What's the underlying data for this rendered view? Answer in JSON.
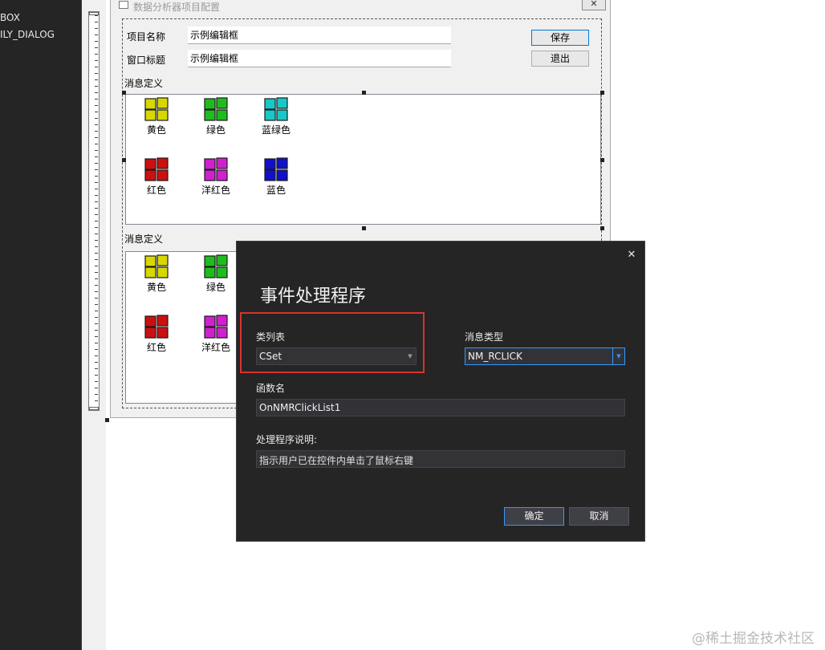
{
  "left_panel": {
    "tree_items": [
      "BOX",
      "ILY_DIALOG"
    ]
  },
  "design_dialog": {
    "title": "数据分析器项目配置",
    "close_glyph": "✕",
    "fields": [
      {
        "label": "项目名称",
        "value": "示例编辑框"
      },
      {
        "label": "窗口标题",
        "value": "示例编辑框"
      }
    ],
    "buttons": {
      "save": "保存",
      "exit": "退出"
    },
    "group1_label": "消息定义",
    "group2_label": "消息定义",
    "list1_items": [
      {
        "label": "黄色",
        "color": "#d8d800"
      },
      {
        "label": "绿色",
        "color": "#1ebd1e"
      },
      {
        "label": "蓝绿色",
        "color": "#18c8c8"
      },
      {
        "label": "红色",
        "color": "#cc1010"
      },
      {
        "label": "洋红色",
        "color": "#d020d0"
      },
      {
        "label": "蓝色",
        "color": "#1010c8"
      }
    ],
    "list2_items": [
      {
        "label": "黄色",
        "color": "#d8d800"
      },
      {
        "label": "绿色",
        "color": "#1ebd1e"
      },
      {
        "label": "红色",
        "color": "#cc1010"
      },
      {
        "label": "洋红色",
        "color": "#d020d0"
      }
    ]
  },
  "event_dialog": {
    "title": "事件处理程序",
    "close_glyph": "✕",
    "class_list_label": "类列表",
    "class_list_value": "CSet",
    "message_type_label": "消息类型",
    "message_type_value": "NM_RCLICK",
    "function_name_label": "函数名",
    "function_name_value": "OnNMRClickList1",
    "description_label": "处理程序说明:",
    "description_value": "指示用户已在控件内单击了鼠标右键",
    "ok_label": "确定",
    "cancel_label": "取消",
    "highlight_color": "#d9332b",
    "accent_color": "#3399ff"
  },
  "watermark": "@稀土掘金技术社区"
}
